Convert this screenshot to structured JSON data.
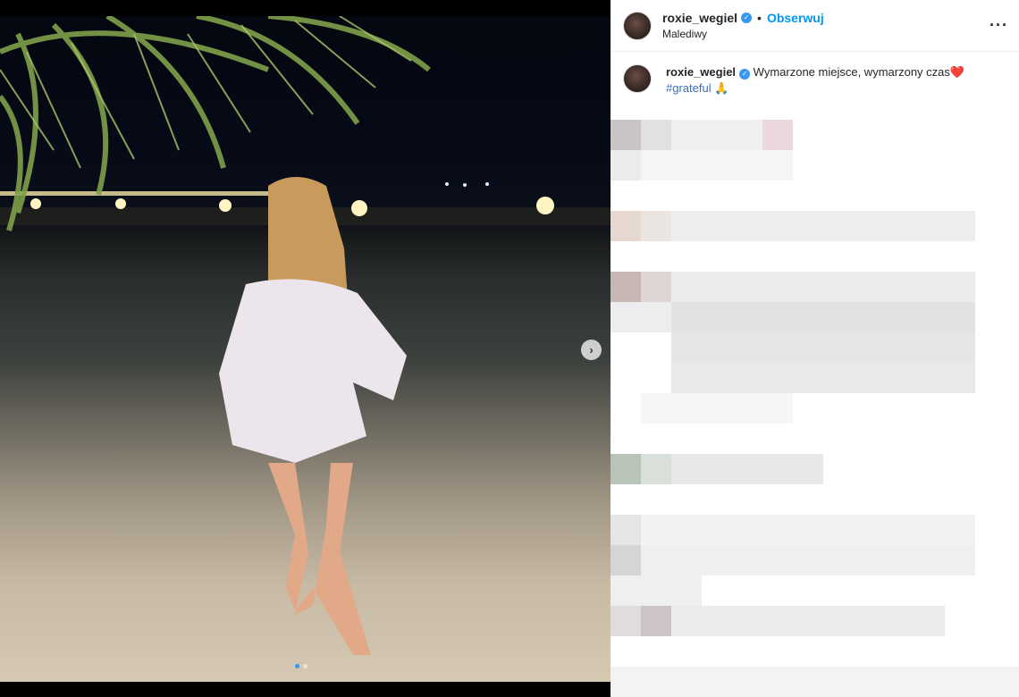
{
  "post": {
    "username": "roxie_wegiel",
    "separator": "•",
    "follow_label": "Obserwuj",
    "location": "Malediwy",
    "more_label": "···"
  },
  "caption": {
    "username": "roxie_wegiel",
    "text": "Wymarzone miejsce, wymarzony czas",
    "emoji_heart": "❤️",
    "hashtag": "#grateful",
    "emoji_hands": "🙏"
  },
  "carousel": {
    "next_label": "›",
    "slides": 2,
    "active_slide": 1
  },
  "colors": {
    "verified": "#3897f0",
    "follow": "#0095f6",
    "hashtag": "#3b6fb6",
    "text": "#262626"
  }
}
